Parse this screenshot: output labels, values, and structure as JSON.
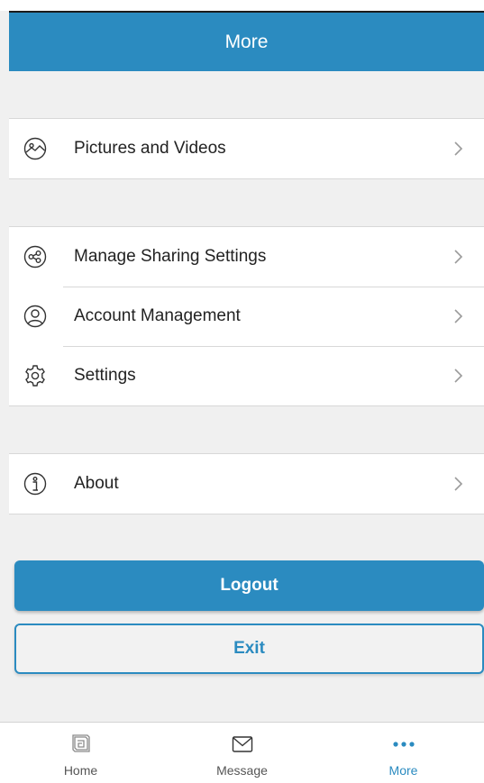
{
  "header": {
    "title": "More"
  },
  "groups": [
    {
      "items": [
        {
          "label": "Pictures and Videos",
          "icon": "pictures-icon"
        }
      ]
    },
    {
      "items": [
        {
          "label": "Manage Sharing Settings",
          "icon": "share-icon"
        },
        {
          "label": "Account Management",
          "icon": "account-icon"
        },
        {
          "label": "Settings",
          "icon": "gear-icon"
        }
      ]
    },
    {
      "items": [
        {
          "label": "About",
          "icon": "info-icon"
        }
      ]
    }
  ],
  "buttons": {
    "logout": "Logout",
    "exit": "Exit"
  },
  "tabbar": {
    "items": [
      {
        "label": "Home",
        "icon": "home-icon"
      },
      {
        "label": "Message",
        "icon": "envelope-icon"
      },
      {
        "label": "More",
        "icon": "more-dots-icon",
        "active": true
      }
    ]
  },
  "colors": {
    "accent": "#2b8bc0",
    "background": "#f0f0f0",
    "surface": "#ffffff",
    "divider": "#d8d8d8"
  }
}
